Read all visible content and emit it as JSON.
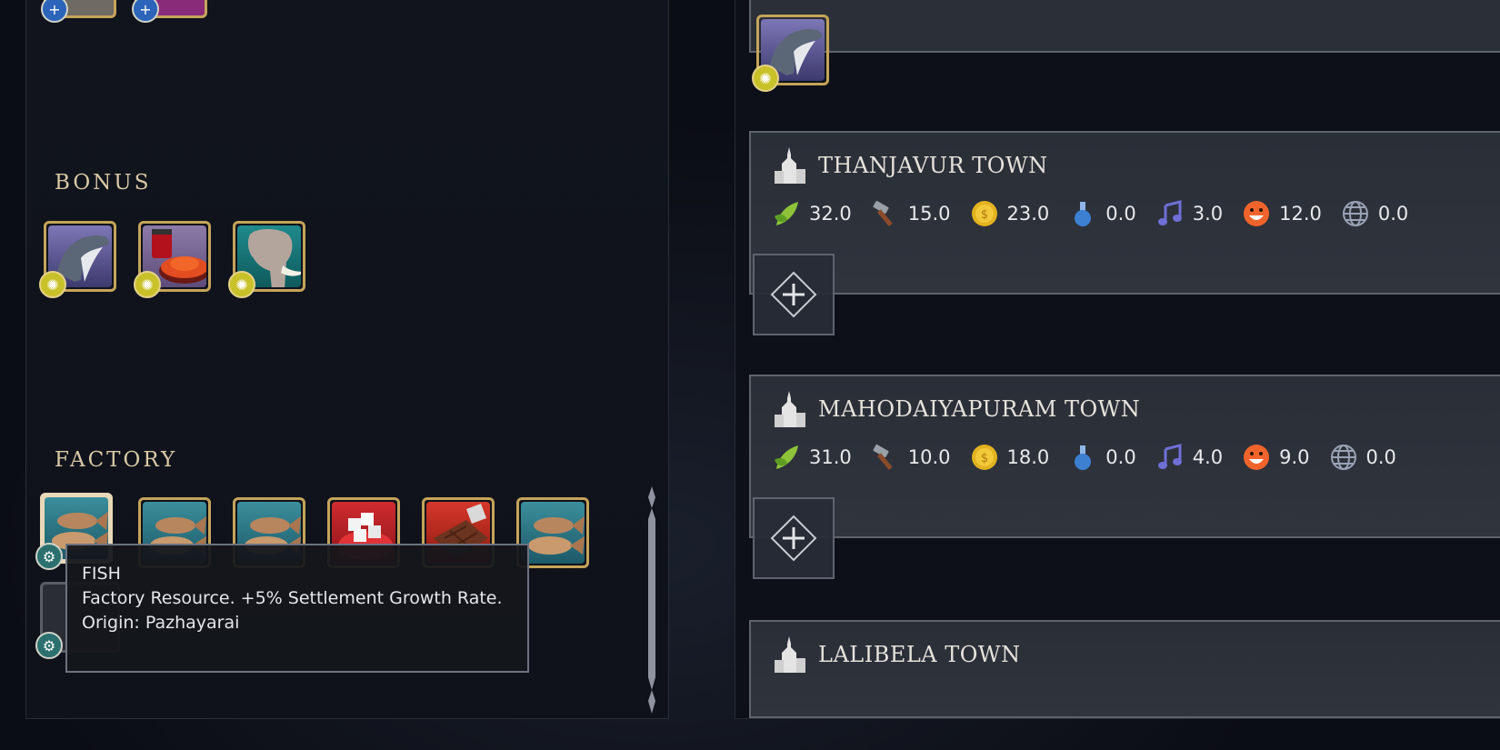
{
  "sections": {
    "bonus_label": "BONUS",
    "factory_label": "FACTORY"
  },
  "bonus_resources": [
    {
      "name": "whale-icon"
    },
    {
      "name": "spices-icon"
    },
    {
      "name": "ivory-icon"
    }
  ],
  "factory_resources": [
    {
      "name": "fish-icon"
    },
    {
      "name": "fish-icon"
    },
    {
      "name": "fish-icon"
    },
    {
      "name": "sugar-icon"
    },
    {
      "name": "chocolate-icon"
    },
    {
      "name": "fish-icon"
    }
  ],
  "tooltip": {
    "title": "FISH",
    "line1": "Factory Resource. +5% Settlement Growth Rate.",
    "line2": "Origin: Pazhayarai"
  },
  "colors": {
    "gold_border": "#c5a45a",
    "bonus_badge": "#c9c12a",
    "factory_badge": "#2b6f6e",
    "card_bg": "#2e323b"
  },
  "towns": [
    {
      "name": "THANJAVUR TOWN",
      "yields": {
        "food": "32.0",
        "production": "15.0",
        "gold": "23.0",
        "science": "0.0",
        "culture": "3.0",
        "happiness": "12.0",
        "influence": "0.0"
      }
    },
    {
      "name": "MAHODAIYAPURAM TOWN",
      "yields": {
        "food": "31.0",
        "production": "10.0",
        "gold": "18.0",
        "science": "0.0",
        "culture": "4.0",
        "happiness": "9.0",
        "influence": "0.0"
      }
    },
    {
      "name": "LALIBELA TOWN"
    }
  ]
}
